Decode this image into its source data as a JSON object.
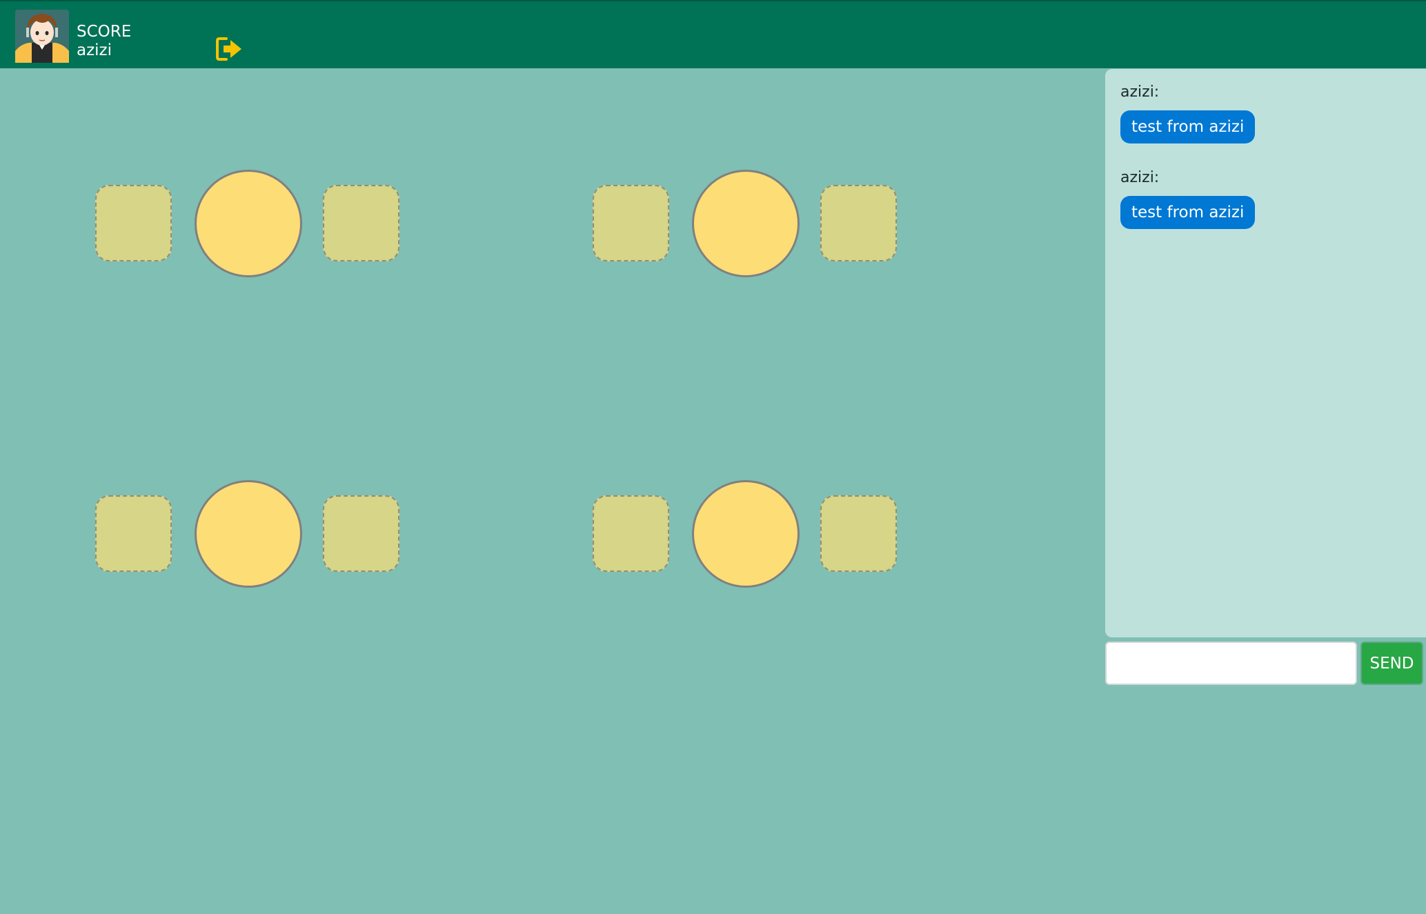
{
  "header": {
    "score_label": "SCORE",
    "username": "azizi",
    "avatar_icon": "user-avatar-icon",
    "exit_icon": "exit-door-arrow-icon",
    "exit_icon_color": "#f5c400",
    "background_color": "#007256"
  },
  "tables": [
    {
      "id": "table-1"
    },
    {
      "id": "table-2"
    },
    {
      "id": "table-3"
    },
    {
      "id": "table-4"
    }
  ],
  "chat": {
    "messages": [
      {
        "sender": "azizi:",
        "text": "test from azizi"
      },
      {
        "sender": "azizi:",
        "text": "test from azizi"
      }
    ],
    "input_value": "",
    "send_label": "SEND"
  },
  "colors": {
    "page_background": "#80bfb4",
    "seat_fill": "#d6d588",
    "table_fill": "#fcdd76",
    "chat_panel": "#bfe1dc",
    "bubble": "#0078d4",
    "send_button": "#28a745"
  }
}
